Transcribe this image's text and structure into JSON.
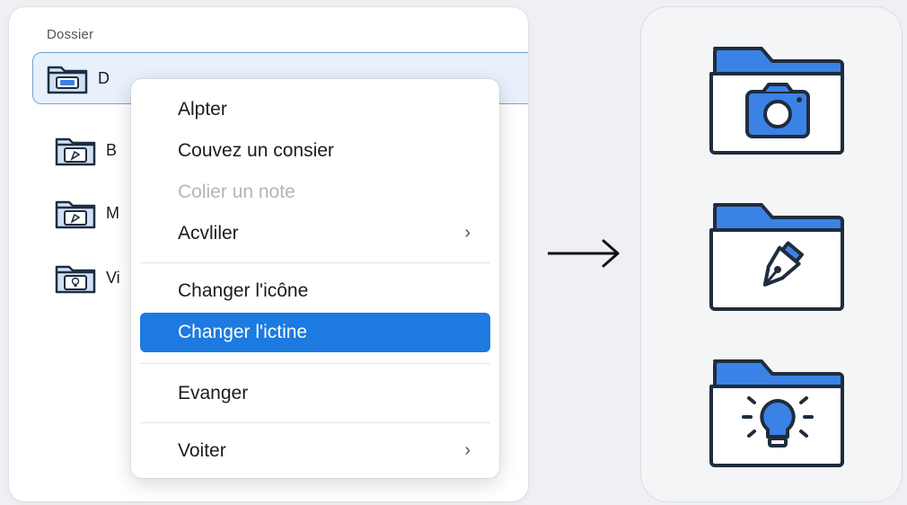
{
  "panel": {
    "title": "Dossier",
    "folders": [
      {
        "label": "D",
        "icon": "photo-folder-icon"
      },
      {
        "label": "B",
        "icon": "pen-folder-icon"
      },
      {
        "label": "M",
        "icon": "pen-folder-icon"
      },
      {
        "label": "Vi",
        "icon": "bulb-folder-icon"
      }
    ]
  },
  "menu": {
    "items": [
      {
        "label": "Alpter"
      },
      {
        "label": "Couvez un consier"
      },
      {
        "label": "Colier un note",
        "disabled": true
      },
      {
        "label": "Acvliler",
        "submenu": "›"
      },
      {
        "label": "Changer l'icône"
      },
      {
        "label": "Changer l'ictine",
        "highlighted": true
      },
      {
        "label": "Evanger"
      },
      {
        "label": "Voiter",
        "submenu": "›"
      }
    ]
  },
  "result_icons": [
    "camera-folder-icon",
    "pen-nib-folder-icon",
    "lightbulb-folder-icon"
  ],
  "colors": {
    "accent": "#1c7ae0",
    "folder_blue": "#3b82e6",
    "outline": "#1f2d3d",
    "selection_bg": "#e7f0fb"
  }
}
